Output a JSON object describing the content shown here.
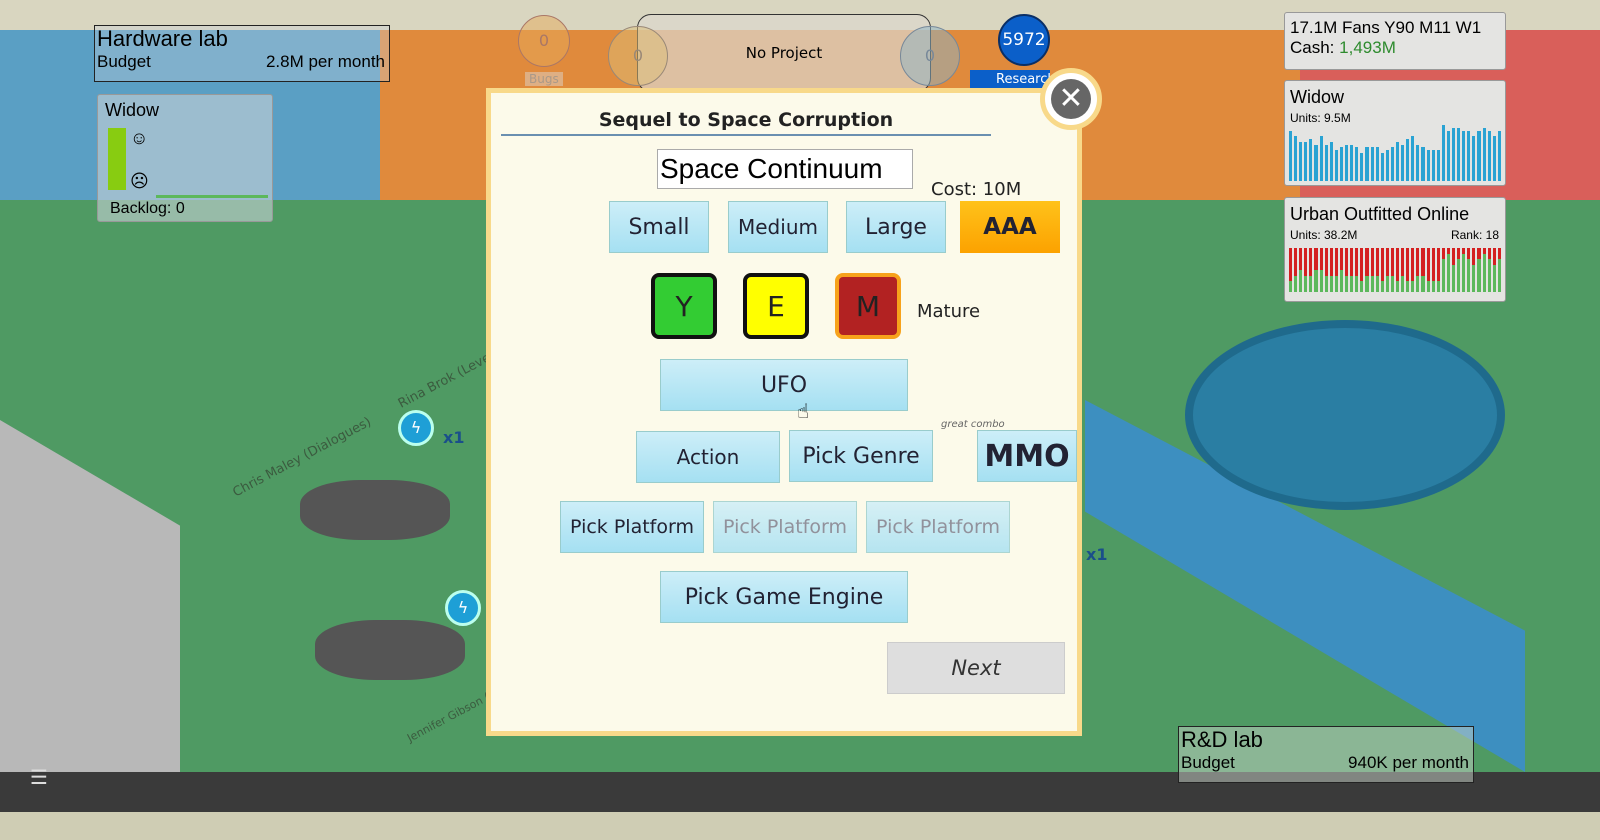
{
  "top_hud": {
    "hardware_lab": {
      "title": "Hardware lab",
      "budget_label": "Budget",
      "budget_value": "2.8M per month"
    },
    "widow_status": {
      "title": "Widow",
      "backlog": "Backlog: 0",
      "happiness_level": 1.0
    },
    "bubbles": [
      "0",
      "0",
      "0"
    ],
    "bugs_label": "Bugs",
    "project_label": "No Project",
    "research_points": "5972",
    "research_label": "Research",
    "stats": {
      "fans_date": "17.1M Fans Y90 M11 W1",
      "cash_label": "Cash:",
      "cash_value": "1,493M",
      "cash_color": "#2e8b2e"
    },
    "sales_widow": {
      "title": "Widow",
      "units": "Units: 9.5M",
      "values": [
        9,
        8,
        7,
        7,
        7.5,
        6.5,
        8,
        6.5,
        7,
        5.5,
        6,
        6.5,
        6.5,
        6,
        5,
        6,
        6,
        6,
        5,
        5.5,
        6,
        7,
        6.5,
        7.5,
        8,
        6.5,
        6,
        5.5,
        5.5,
        5.5,
        10,
        9,
        9.5,
        9.5,
        9,
        9,
        8,
        9,
        9.5,
        9,
        8,
        9
      ],
      "color": "#2aa3d3"
    },
    "sales_urban": {
      "title": "Urban Outfitted Online",
      "units": "Units: 38.2M",
      "rank": "Rank: 18",
      "red_color": "#d42020",
      "green_color": "#5cb85c",
      "green": [
        2,
        3,
        4,
        3,
        3,
        4,
        4,
        3,
        3,
        3,
        4,
        3,
        3,
        3,
        2,
        3,
        3,
        3,
        2,
        3,
        3,
        2,
        3,
        2,
        2,
        3,
        3,
        2,
        2,
        2,
        6,
        7,
        5,
        6,
        7,
        6,
        5,
        6,
        7,
        6,
        5,
        6
      ]
    },
    "rnd_lab": {
      "title": "R&D lab",
      "budget_label": "Budget",
      "budget_value": "940K per month"
    }
  },
  "staff_labels": [
    "Rina Brok (Level Design)",
    "Chris Maley (Dialogues)",
    "Jennifer Gibson (Graphic)"
  ],
  "boost_labels": [
    "x1",
    "x1"
  ],
  "dialog": {
    "title": "Sequel to Space Corruption",
    "name_value": "Space Continuum",
    "cost": "Cost: 10M",
    "sizes": [
      {
        "label": "Small"
      },
      {
        "label": "Medium"
      },
      {
        "label": "Large"
      },
      {
        "label": "AAA",
        "selected": true
      }
    ],
    "ratings": [
      {
        "label": "Y",
        "color": "#33cc33"
      },
      {
        "label": "E",
        "color": "#ffff00"
      },
      {
        "label": "M",
        "color": "#b22222",
        "selected": true
      }
    ],
    "rating_name": "Mature",
    "topic": "UFO",
    "genres": [
      "Action",
      "Pick Genre"
    ],
    "combo_hint": "great combo",
    "combo_genre": "MMO",
    "platforms": [
      "Pick Platform",
      "Pick Platform",
      "Pick Platform"
    ],
    "engine": "Pick Game Engine",
    "next": "Next"
  }
}
